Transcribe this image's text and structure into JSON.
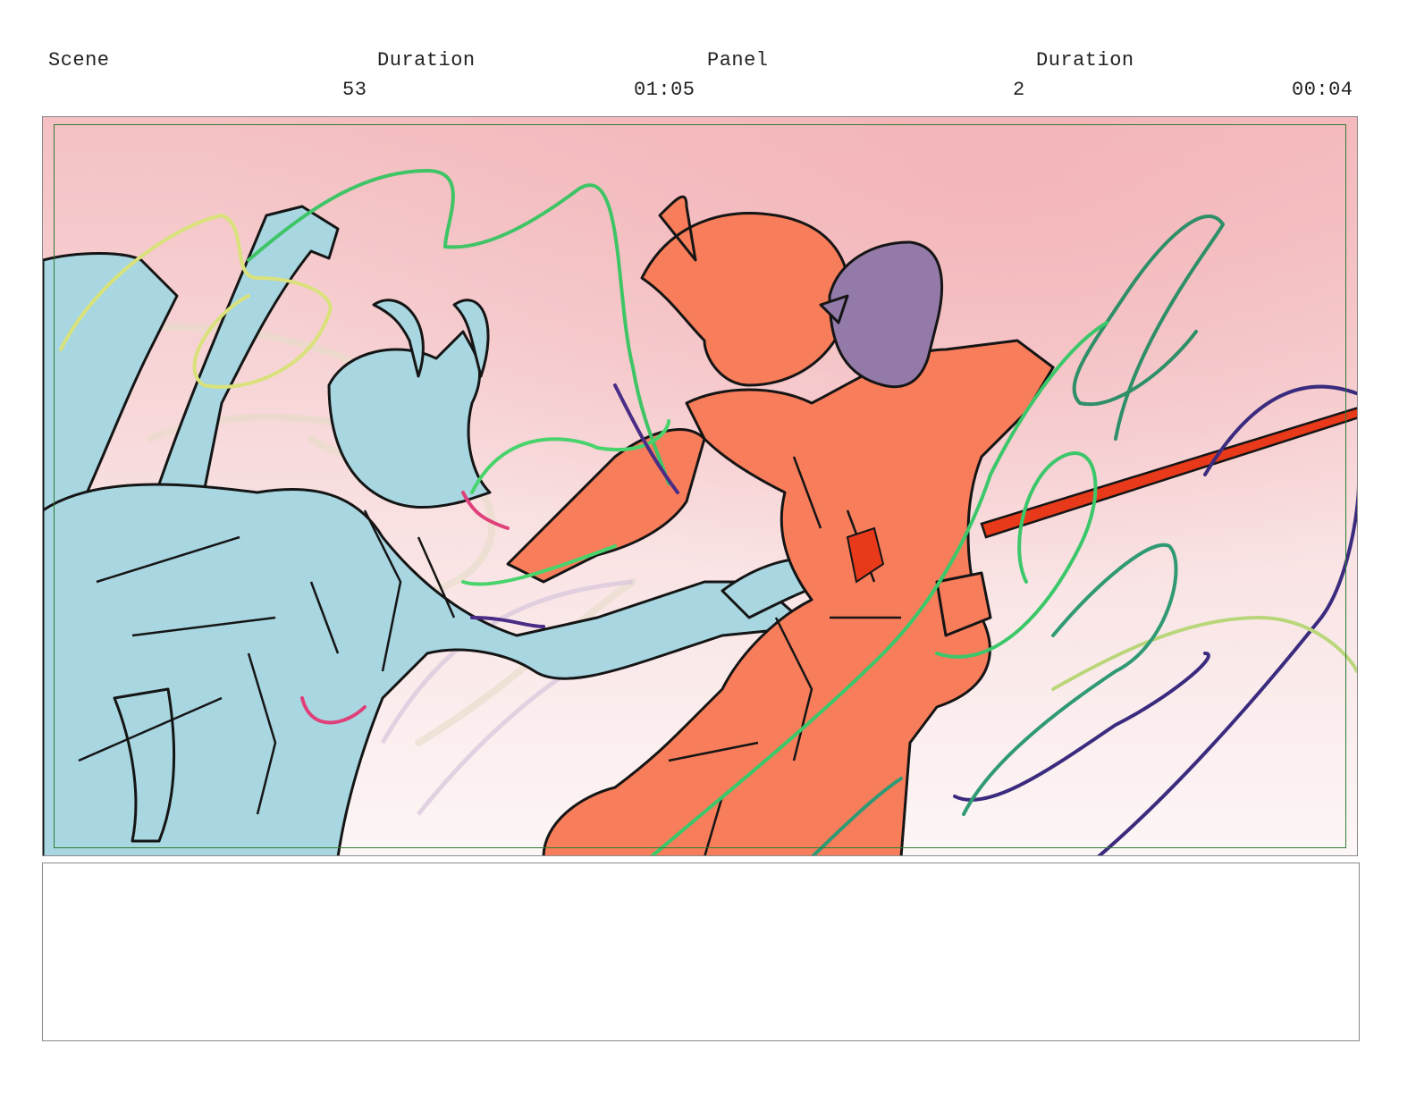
{
  "header": {
    "scene_label": "Scene",
    "scene_duration_label": "Duration",
    "panel_label": "Panel",
    "panel_duration_label": "Duration",
    "scene_number": "53",
    "scene_duration": "01:05",
    "panel_number": "2",
    "panel_duration": "00:04"
  },
  "panel": {
    "background_top": "#f4c0c3",
    "background_bottom": "#fdf6f6",
    "blue_character_color": "#a8d6e1",
    "orange_character_color": "#f87d5b",
    "purple_character_color": "#947aa8",
    "spear_color": "#e8391b",
    "safe_area_color": "#2e7d32"
  },
  "notes": {
    "text": ""
  }
}
